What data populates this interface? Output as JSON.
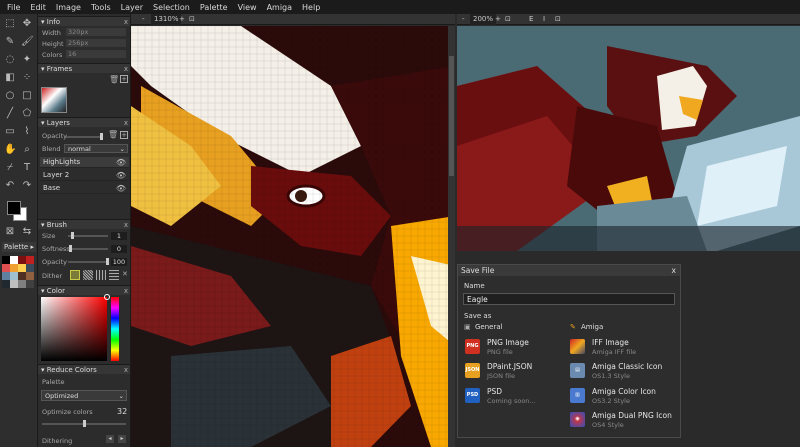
{
  "menu": [
    "File",
    "Edit",
    "Image",
    "Tools",
    "Layer",
    "Selection",
    "Palette",
    "View",
    "Amiga",
    "Help"
  ],
  "info": {
    "title": "Info",
    "width_label": "Width",
    "width_val": "320px",
    "height_label": "Height",
    "height_val": "256px",
    "colors_label": "Colors",
    "colors_val": "16"
  },
  "frames": {
    "title": "Frames"
  },
  "layers": {
    "title": "Layers",
    "opacity_label": "Opacity",
    "blend_label": "Blend",
    "blend_val": "normal",
    "items": [
      "HighLights",
      "Layer 2",
      "Base"
    ]
  },
  "brush": {
    "title": "Brush",
    "size_label": "Size",
    "size_val": "1",
    "softness_label": "Softness",
    "softness_val": "0",
    "opacity_label": "Opacity",
    "opacity_val": "100",
    "dither_label": "Dither"
  },
  "color": {
    "title": "Color"
  },
  "reduce": {
    "title": "Reduce Colors",
    "palette_label": "Palette",
    "palette_val": "Optimized",
    "optimize_label": "Optimize colors",
    "optimize_val": "32",
    "dithering_label": "Dithering"
  },
  "palette_tab": "Palette",
  "canvas1": {
    "zoom": "1310%"
  },
  "canvas2": {
    "zoom": "200%",
    "btn_e": "E",
    "btn_i": "I"
  },
  "close_x": "x",
  "save": {
    "title": "Save File",
    "name_label": "Name",
    "name_val": "Eagle",
    "saveas_label": "Save as",
    "general_label": "General",
    "amiga_label": "Amiga",
    "general": [
      {
        "title": "PNG Image",
        "sub": "PNG file"
      },
      {
        "title": "DPaint.JSON",
        "sub": "JSON file"
      },
      {
        "title": "PSD",
        "sub": "Coming soon..."
      }
    ],
    "amiga": [
      {
        "title": "IFF Image",
        "sub": "Amiga IFF file"
      },
      {
        "title": "Amiga Classic Icon",
        "sub": "OS1.3 Style"
      },
      {
        "title": "Amiga Color Icon",
        "sub": "OS3.2 Style"
      },
      {
        "title": "Amiga Dual PNG Icon",
        "sub": "OS4 Style"
      }
    ]
  },
  "colors": {
    "accent": "#e8a020",
    "panel": "#2c2c2c",
    "dialog": "#2d2d2d",
    "selected_layer": "#3c3c3c"
  }
}
